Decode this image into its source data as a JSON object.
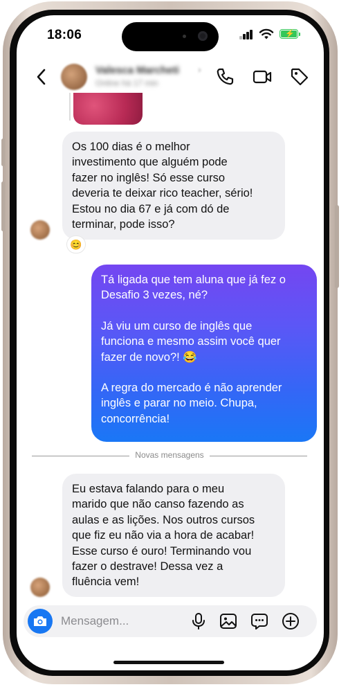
{
  "status_bar": {
    "time": "18:06"
  },
  "header": {
    "contact_name": "Valesca Marcheti",
    "contact_subtitle": "Online há 17 min"
  },
  "messages": {
    "incoming_1": {
      "text": "Os 100 dias é o melhor\ninvestimento que alguém pode\nfazer no inglês!  Só esse curso\ndeveria te deixar rico teacher, sério!\nEstou no dia 67 e já com dó de\nterminar, pode isso?",
      "reaction": "😊"
    },
    "outgoing_1": {
      "paragraphs": [
        "Tá ligada que tem aluna que já fez o\nDesafio 3 vezes, né?",
        "Já viu um curso de inglês que\nfunciona e mesmo assim você quer\nfazer de novo?! 😂",
        "A regra do mercado é não aprender\ninglês e parar no meio. Chupa,\nconcorrência!"
      ]
    },
    "divider_label": "Novas mensagens",
    "incoming_2": {
      "text": "Eu estava falando para o meu\nmarido que não canso fazendo as\naulas e as lições. Nos outros cursos\nque fiz eu não via a hora de acabar!\nEsse curso é ouro! Terminando vou\nfazer o destrave! Dessa vez a\nfluência vem!"
    }
  },
  "composer": {
    "placeholder": "Mensagem..."
  },
  "colors": {
    "accent_blue": "#1877f2",
    "bubble_gradient_top": "#7446f1",
    "bubble_gradient_bottom": "#1a77f6",
    "incoming_bubble": "#efeff2",
    "battery_green": "#34c759"
  },
  "icons": [
    "back-chevron-icon",
    "phone-icon",
    "video-camera-icon",
    "tag-icon",
    "camera-icon",
    "microphone-icon",
    "image-icon",
    "sticker-icon",
    "plus-icon"
  ]
}
